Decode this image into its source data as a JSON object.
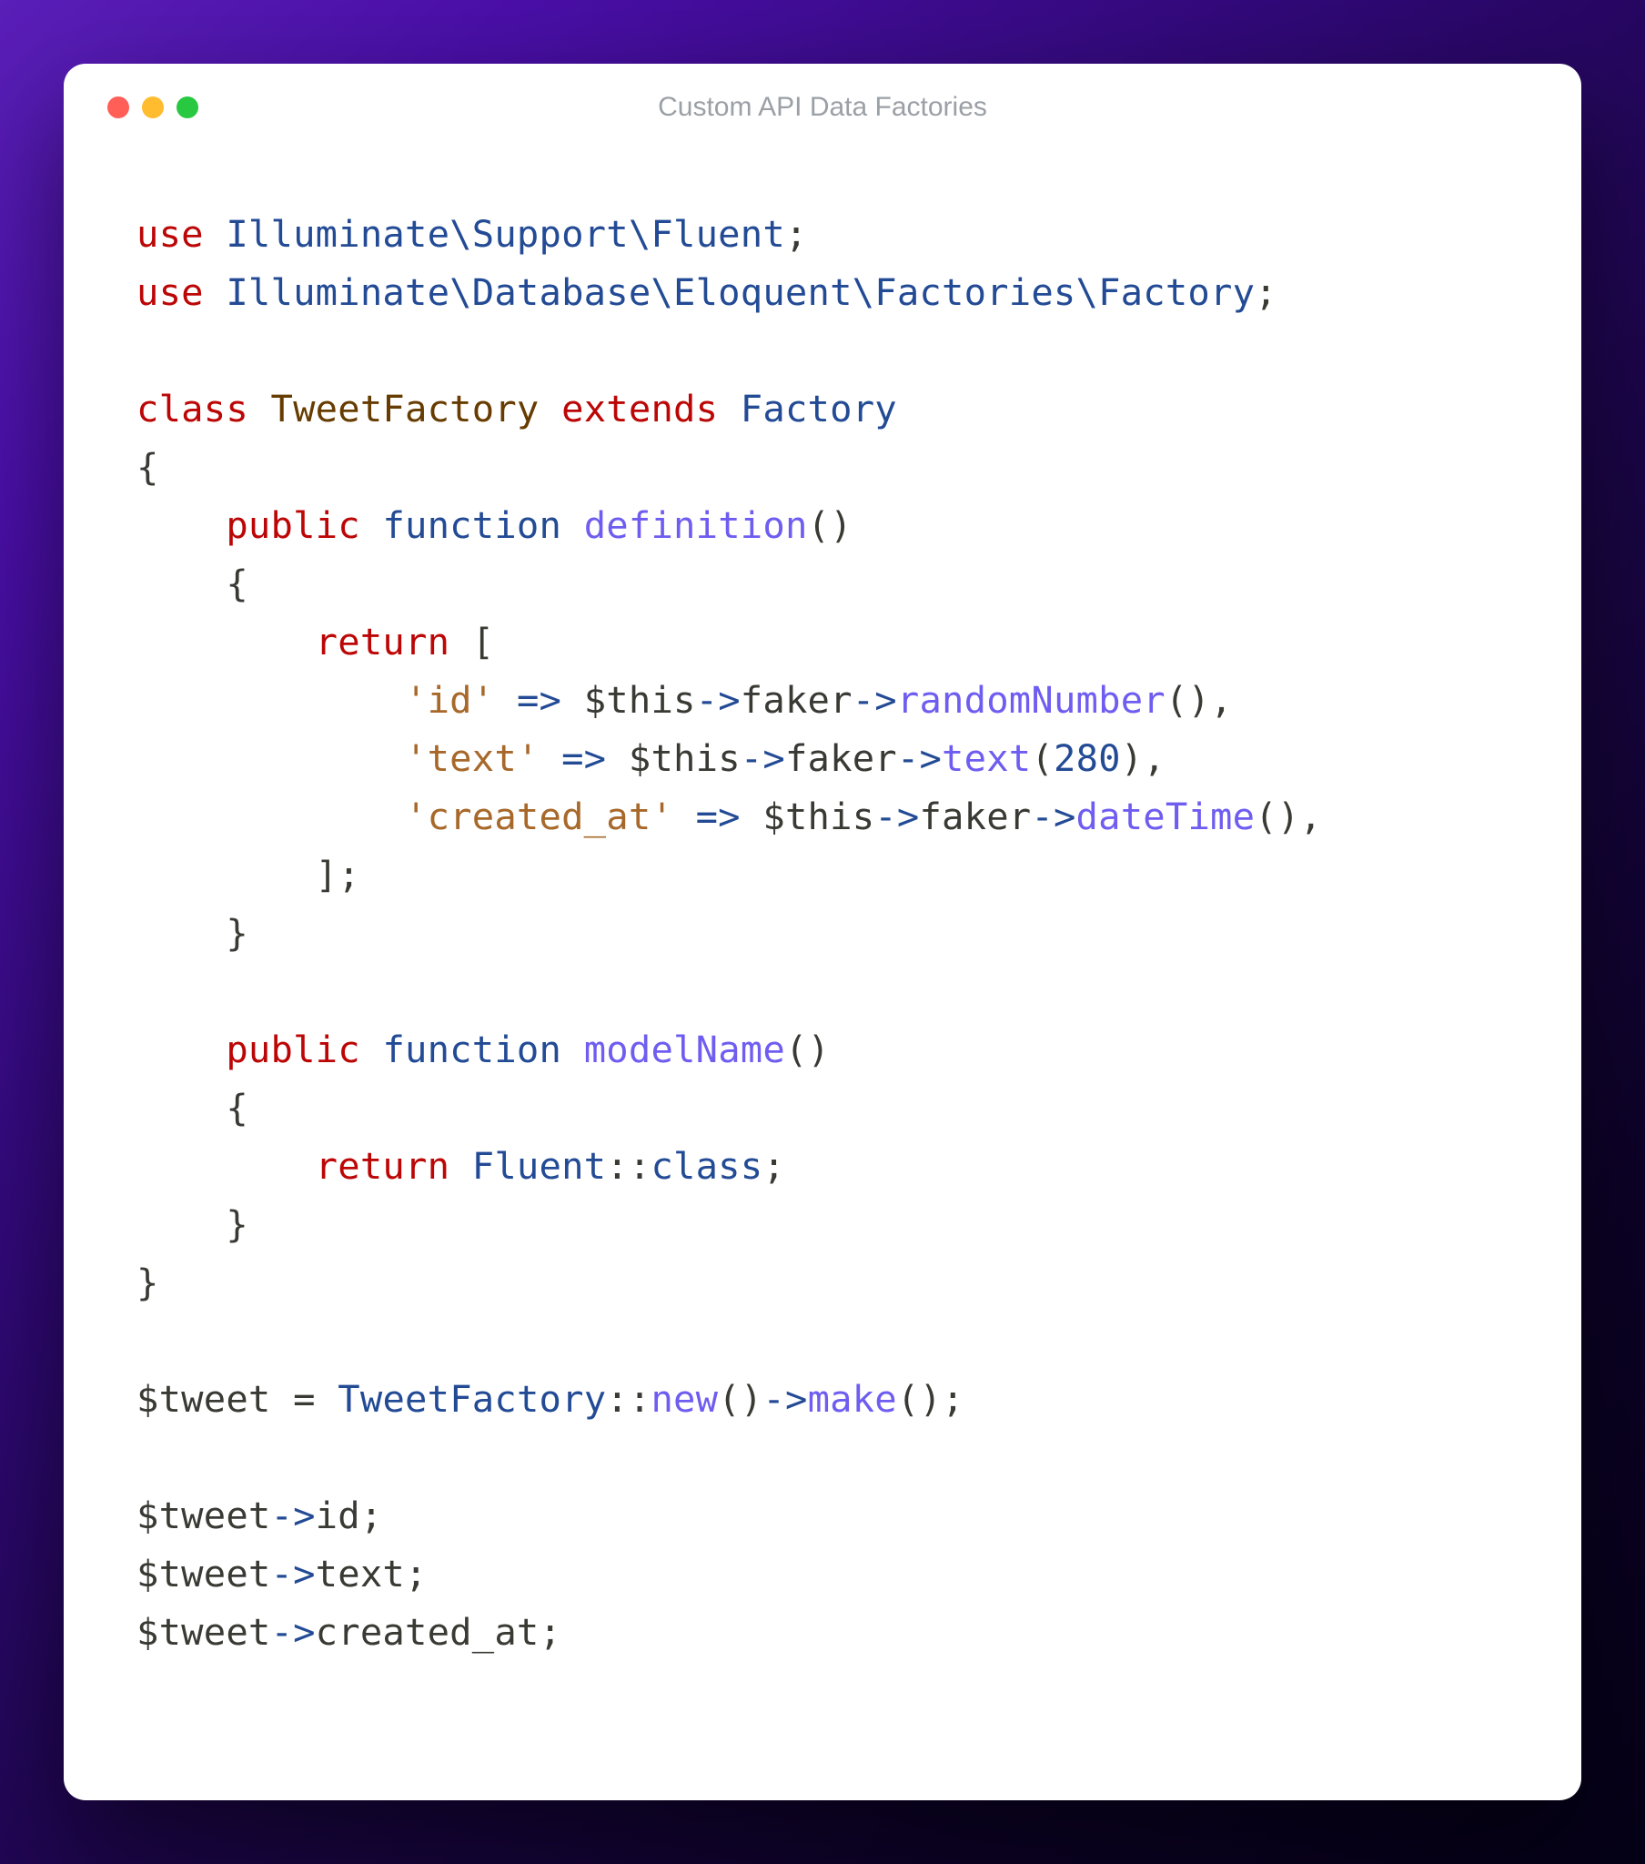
{
  "title": "Custom API Data Factories",
  "trafficLights": {
    "red": "#ff5f57",
    "yellow": "#febc2e",
    "green": "#28c840"
  },
  "code": {
    "use": "use",
    "ns_fluent": "Illuminate\\Support\\Fluent",
    "ns_factory": "Illuminate\\Database\\Eloquent\\Factories\\Factory",
    "class": "class",
    "className": "TweetFactory",
    "extends": "extends",
    "parentClass": "Factory",
    "public": "public",
    "function": "function",
    "fn_definition": "definition",
    "fn_modelName": "modelName",
    "return": "return",
    "str_id": "'id'",
    "str_text": "'text'",
    "str_created_at": "'created_at'",
    "fat_arrow": "=>",
    "arrow": "->",
    "var_this": "$this",
    "prop_faker": "faker",
    "m_randomNumber": "randomNumber",
    "m_text": "text",
    "m_dateTime": "dateTime",
    "num_280": "280",
    "fluent": "Fluent",
    "class_const": "class",
    "dcolon": "::",
    "var_tweet": "$tweet",
    "m_new": "new",
    "m_make": "make",
    "prop_id": "id",
    "prop_text": "text",
    "prop_created_at": "created_at",
    "semi": ";",
    "lparen": "(",
    "rparen": ")",
    "lbrace": "{",
    "rbrace": "}",
    "lbracket": "[",
    "rbracket": "]",
    "comma": ",",
    "eq": "="
  }
}
